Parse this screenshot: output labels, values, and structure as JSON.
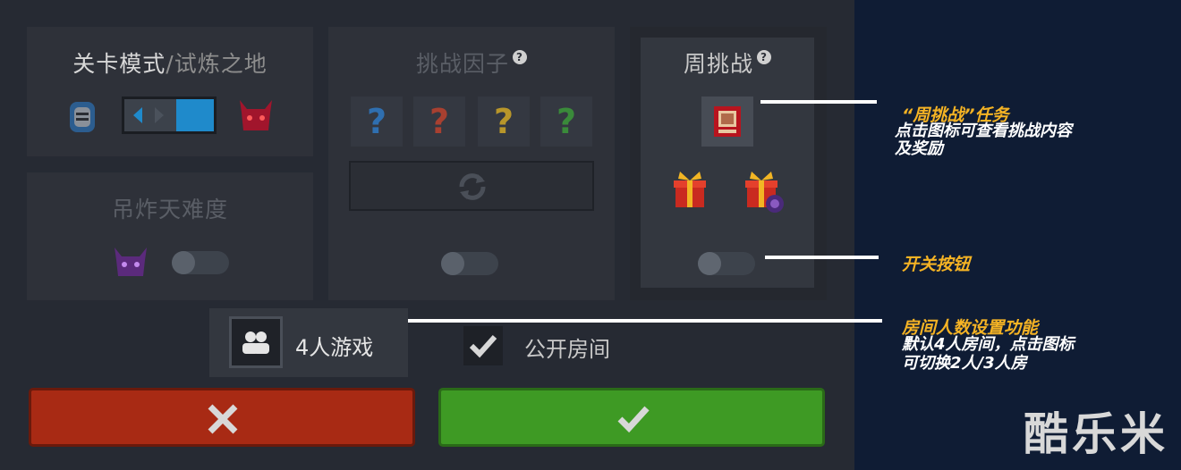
{
  "level_mode": {
    "title": "关卡模式",
    "separator": "/",
    "subtitle": "试炼之地",
    "left_icon": "knight-helmet-icon",
    "right_icon": "demon-helmet-icon"
  },
  "hanging_difficulty": {
    "title": "吊炸天难度",
    "icon": "purple-demon-helmet-icon",
    "toggle_on": false
  },
  "challenge_factors": {
    "title": "挑战因子",
    "help_icon": "?",
    "factors": [
      "?",
      "?",
      "?",
      "?"
    ],
    "factor_colors": [
      "#2f6fb0",
      "#a84030",
      "#b8962a",
      "#3a8a3a"
    ],
    "refresh_icon": "refresh-icon",
    "toggle_on": false
  },
  "weekly_challenge": {
    "title": "周挑战",
    "help_icon": "?",
    "task_icon": "task-card-icon",
    "reward_icons": [
      "gift-box-icon",
      "gift-box-bomb-icon"
    ],
    "toggle_on": false
  },
  "player_count": {
    "label": "4人游戏",
    "icon": "players-icon"
  },
  "public_room": {
    "label": "公开房间",
    "checked": true
  },
  "cancel_button": {
    "icon": "close-icon",
    "color": "#a82a14"
  },
  "confirm_button": {
    "icon": "check-icon",
    "color": "#3e9a24"
  },
  "annotations": {
    "weekly_task": {
      "title": "“周挑战”任务",
      "text": [
        "点击图标可查看挑战内容",
        "及奖励"
      ]
    },
    "toggle": {
      "title": "开关按钮"
    },
    "room": {
      "title": "房间人数设置功能",
      "text": [
        "默认4人房间，点击图标",
        "可切换2人/3人房"
      ]
    }
  },
  "watermark": "酷乐米",
  "colors": {
    "accent_orange": "#f5b324",
    "panel_dark": "#2e3139",
    "right_bg": "#0f1c34"
  }
}
